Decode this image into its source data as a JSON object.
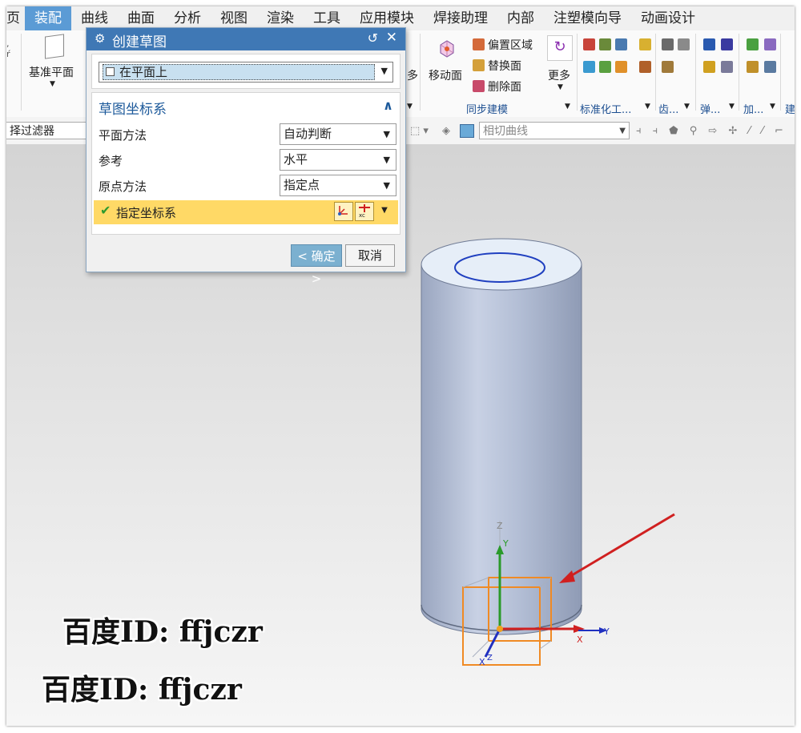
{
  "menubar": {
    "items": [
      "页",
      "装配",
      "曲线",
      "曲面",
      "分析",
      "视图",
      "渲染",
      "工具",
      "应用模块",
      "焊接助理",
      "内部",
      "注塑模向导",
      "动画设计"
    ],
    "active_index": 1
  },
  "ribbon": {
    "datum_plane_label": "基准平面",
    "move_face_label": "移动面",
    "offset_region_label": "偏置区域",
    "replace_face_label": "替换面",
    "delete_face_label": "删除面",
    "more_label": "更多",
    "more_left_label": "多",
    "sync_group_label": "同步建模",
    "std_parts_label": "标准化工...",
    "gear_label": "齿...",
    "spring_label": "弹...",
    "add_label": "加...",
    "last_label": "建"
  },
  "filterbar": {
    "filter_label": "择过滤器",
    "curve_rule_value": "相切曲线"
  },
  "dialog": {
    "title": "创建草图",
    "sketch_type_value": "在平面上",
    "section_title": "草图坐标系",
    "rows": [
      {
        "label": "平面方法",
        "value": "自动判断"
      },
      {
        "label": "参考",
        "value": "水平"
      },
      {
        "label": "原点方法",
        "value": "指定点"
      }
    ],
    "specify_csys_label": "指定坐标系",
    "xc_label": "xc",
    "ok_label": "确定",
    "cancel_label": "取消"
  },
  "viewport": {
    "triad_labels": {
      "z": "Z",
      "y": "Y",
      "x": "X",
      "y2": "Y",
      "x2": "X",
      "z2": "Z"
    }
  },
  "watermarks": [
    "百度ID: ffjczr",
    "百度ID: ffjczr"
  ],
  "colors": {
    "accent": "#3f78b5",
    "menu_active": "#5b9bd5",
    "highlight_row": "#ffd966",
    "cylinder": "#b4bfd6",
    "arrow": "#d02020",
    "csys_box": "#f08a24"
  }
}
